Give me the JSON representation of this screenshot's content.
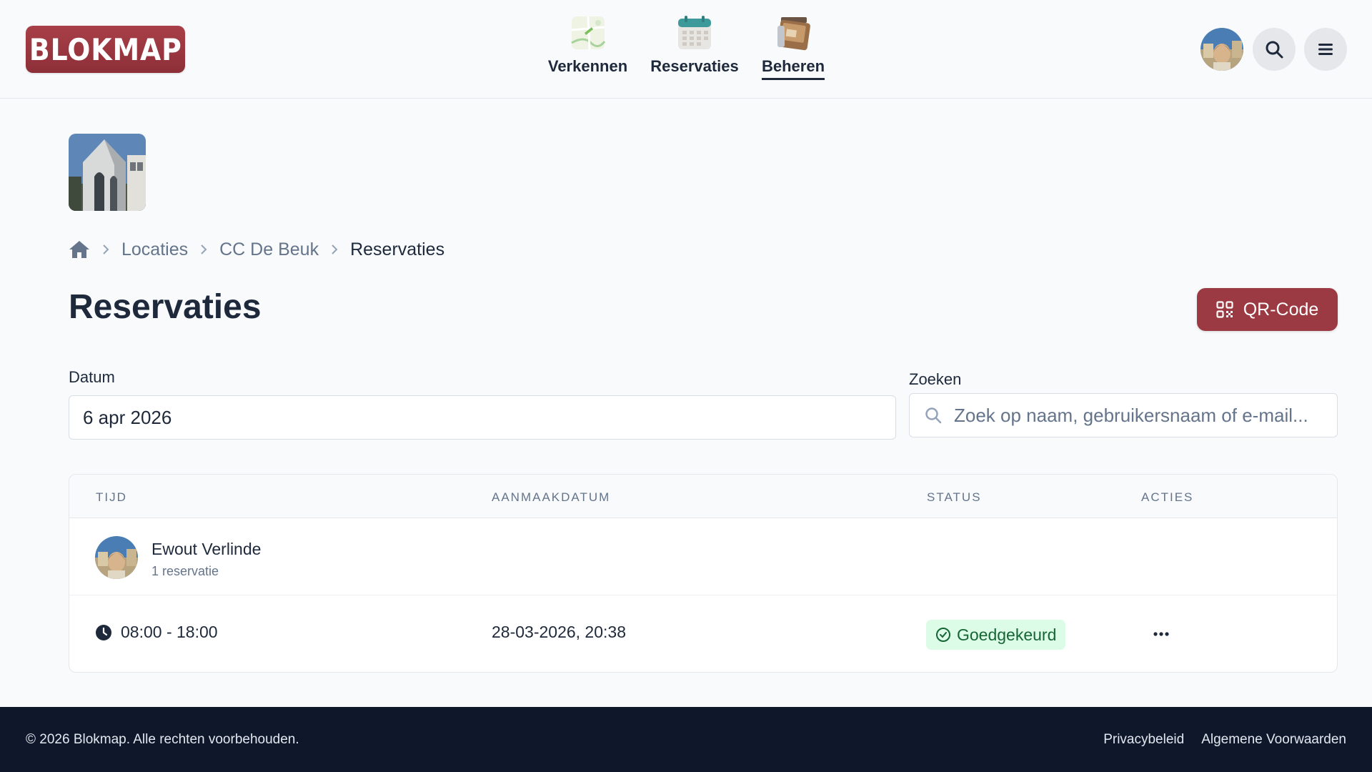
{
  "brand": {
    "logo_text": "BLOKMAP",
    "accent": "#9b3a42"
  },
  "nav": {
    "items": [
      {
        "label": "Verkennen",
        "icon": "map-icon",
        "active": false
      },
      {
        "label": "Reservaties",
        "icon": "calendar-icon",
        "active": false
      },
      {
        "label": "Beheren",
        "icon": "manage-icon",
        "active": true
      }
    ]
  },
  "header_actions": {
    "avatar": "user-avatar",
    "search_icon": "search-icon",
    "menu_icon": "menu-icon"
  },
  "breadcrumb": {
    "home_icon": "home-icon",
    "items": [
      "Locaties",
      "CC De Beuk",
      "Reservaties"
    ]
  },
  "page": {
    "title": "Reservaties",
    "qr_button": "QR-Code"
  },
  "filters": {
    "date_label": "Datum",
    "date_value": "6 apr 2026",
    "search_label": "Zoeken",
    "search_placeholder": "Zoek op naam, gebruikersnaam of e-mail..."
  },
  "table": {
    "headers": [
      "TIJD",
      "AANMAAKDATUM",
      "STATUS",
      "ACTIES"
    ],
    "groups": [
      {
        "user_name": "Ewout Verlinde",
        "count_label": "1 reservatie",
        "rows": [
          {
            "time": "08:00 - 18:00",
            "created": "28-03-2026, 20:38",
            "status": "Goedgekeurd",
            "status_color": "#166534"
          }
        ]
      }
    ]
  },
  "footer": {
    "copyright": "© 2026 Blokmap. Alle rechten voorbehouden.",
    "links": [
      "Privacybeleid",
      "Algemene Voorwaarden"
    ]
  }
}
